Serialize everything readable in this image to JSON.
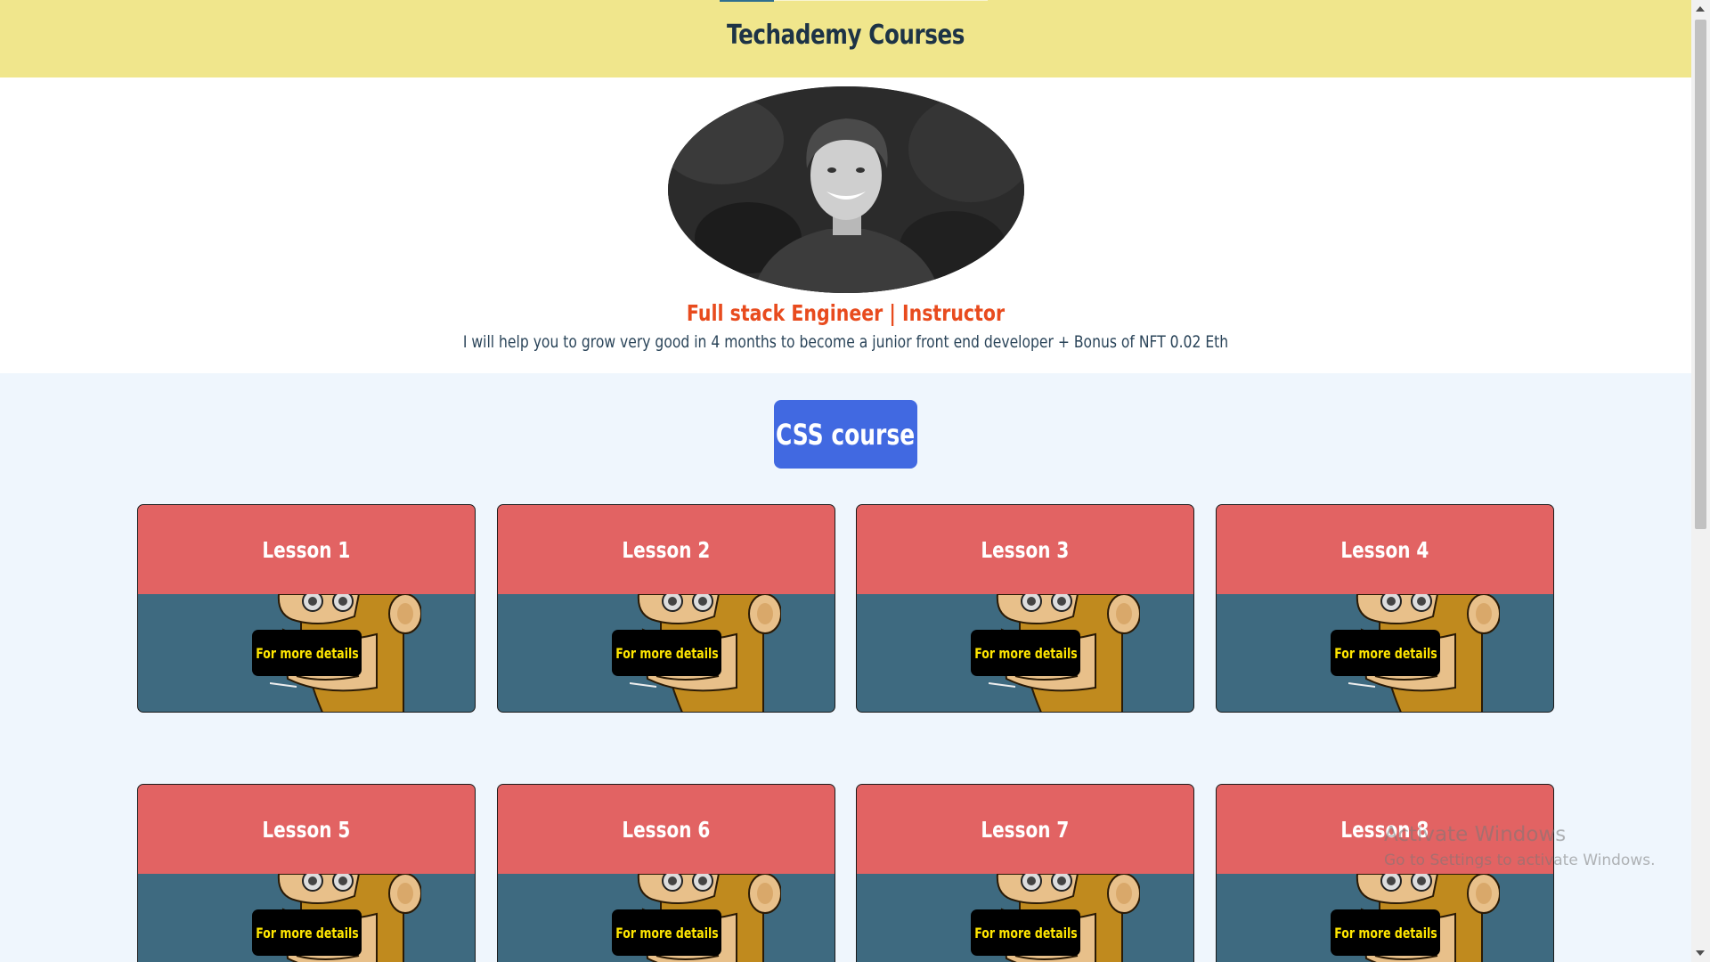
{
  "header": {
    "title": "Techademy Courses"
  },
  "profile": {
    "role": "Full stack Engineer | Instructor",
    "bio": "I will help you to grow very good in 4 months to become a junior front end developer + Bonus of NFT 0.02 Eth"
  },
  "course": {
    "button_label": "CSS course"
  },
  "lessons": [
    {
      "title": "Lesson 1",
      "button": "For more details"
    },
    {
      "title": "Lesson 2",
      "button": "For more details"
    },
    {
      "title": "Lesson 3",
      "button": "For more details"
    },
    {
      "title": "Lesson 4",
      "button": "For more details"
    },
    {
      "title": "Lesson 5",
      "button": "For more details"
    },
    {
      "title": "Lesson 6",
      "button": "For more details"
    },
    {
      "title": "Lesson 7",
      "button": "For more details"
    },
    {
      "title": "Lesson 8",
      "button": "For more details"
    }
  ],
  "os_watermark": {
    "line1": "Activate Windows",
    "line2": "Go to Settings to activate Windows."
  },
  "colors": {
    "header_bg": "#f0e68c",
    "accent_blue": "#4169e1",
    "card_top": "#e26363",
    "card_bottom": "#3e6a80",
    "role_text": "#e84b1e",
    "details_text": "#ffe600"
  }
}
